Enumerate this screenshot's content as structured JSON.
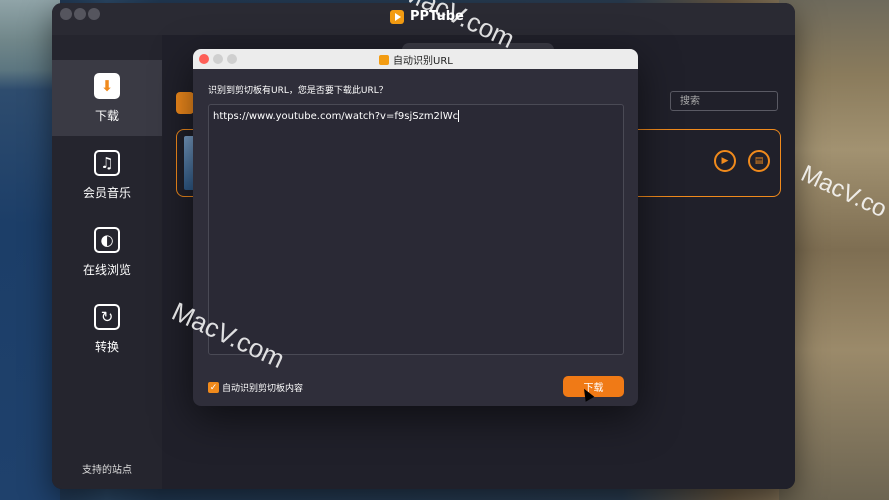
{
  "app": {
    "title": "PPTube"
  },
  "sidebar": {
    "items": [
      {
        "label": "下载",
        "icon": "download-icon"
      },
      {
        "label": "会员音乐",
        "icon": "music-icon"
      },
      {
        "label": "在线浏览",
        "icon": "globe-icon"
      },
      {
        "label": "转换",
        "icon": "convert-icon"
      }
    ],
    "footer": "支持的站点"
  },
  "main": {
    "search_placeholder": "搜索"
  },
  "dialog": {
    "title": "自动识别URL",
    "message": "识别到剪切板有URL，您是否要下载此URL？",
    "url": "https://www.youtube.com/watch?v=f9sjSzm2lWc",
    "checkbox_label": "自动识别剪切板内容",
    "checkbox_checked": true,
    "download_button": "下载"
  },
  "watermarks": [
    "MacV.com",
    "MacV.com",
    "MacV.co"
  ],
  "colors": {
    "accent": "#f08a1c",
    "window_bg": "#1e1e26",
    "sidebar_bg": "#25252e"
  }
}
